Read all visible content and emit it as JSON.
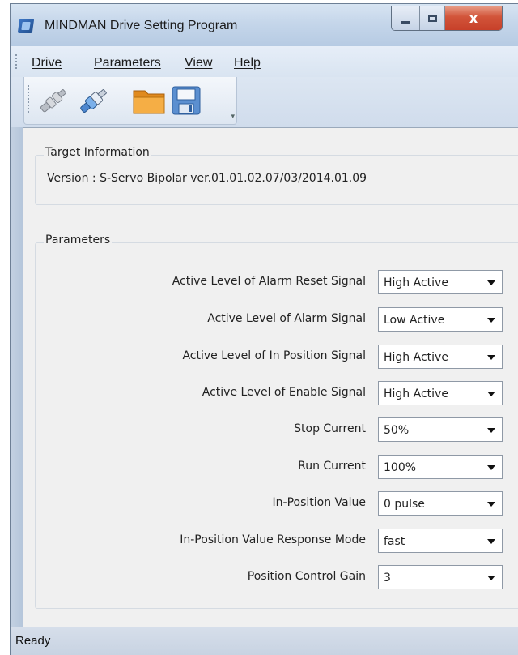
{
  "window": {
    "title": "MINDMAN Drive Setting Program",
    "close_glyph": "x"
  },
  "menu": {
    "items": [
      {
        "label": "Drive"
      },
      {
        "label": "Parameters"
      },
      {
        "label": "View"
      },
      {
        "label": "Help"
      }
    ]
  },
  "toolbar": {
    "buttons": [
      {
        "icon": "disconnect-icon"
      },
      {
        "icon": "connect-icon"
      },
      {
        "icon": "open-folder-icon"
      },
      {
        "icon": "save-icon"
      }
    ]
  },
  "target_info": {
    "title": "Target Information",
    "version": "Version : S-Servo Bipolar ver.01.01.02.07/03/2014.01.09"
  },
  "parameters": {
    "title": "Parameters",
    "rows": [
      {
        "label": "Active Level of Alarm Reset Signal",
        "value": "High Active"
      },
      {
        "label": "Active Level of Alarm Signal",
        "value": "Low Active"
      },
      {
        "label": "Active Level of In Position Signal",
        "value": "High Active"
      },
      {
        "label": "Active Level of Enable Signal",
        "value": "High Active"
      },
      {
        "label": "Stop Current",
        "value": "50%"
      },
      {
        "label": "Run Current",
        "value": "100%"
      },
      {
        "label": "In-Position Value",
        "value": "0 pulse"
      },
      {
        "label": "In-Position Value Response Mode",
        "value": "fast"
      },
      {
        "label": "Position Control Gain",
        "value": "3"
      }
    ]
  },
  "status": {
    "text": "Ready"
  },
  "colors": {
    "title_gradient_top": "#d7e4f2",
    "close_button": "#c7402a",
    "folder": "#f0a53a",
    "save_disk": "#5b8fd0"
  }
}
